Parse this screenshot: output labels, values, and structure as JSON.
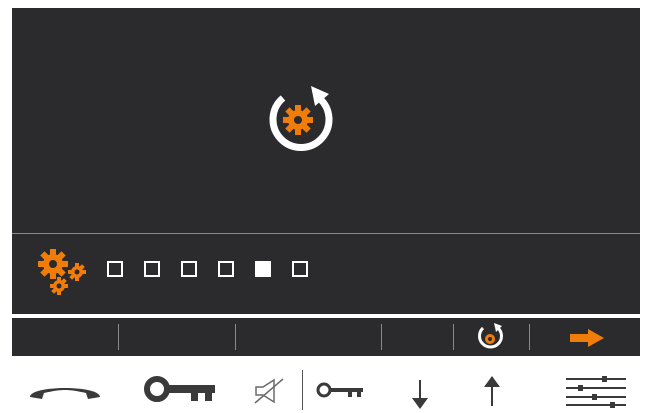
{
  "screen": {
    "center_icon": "settings-refresh-icon",
    "progress": {
      "total_steps": 6,
      "current_step": 5,
      "icon": "gears-icon"
    }
  },
  "softkeys": [
    {
      "name": "softkey-1",
      "icon": ""
    },
    {
      "name": "softkey-2",
      "icon": ""
    },
    {
      "name": "softkey-3",
      "icon": ""
    },
    {
      "name": "softkey-4",
      "icon": ""
    },
    {
      "name": "softkey-5",
      "icon": "settings-refresh-icon"
    },
    {
      "name": "softkey-6",
      "icon": "arrow-right-icon"
    }
  ],
  "hardware_buttons": [
    {
      "name": "handset-button",
      "icon": "handset-icon"
    },
    {
      "name": "door-key-button",
      "icon": "key-icon"
    },
    {
      "name": "mute-button",
      "icon": "speaker-mute-icon"
    },
    {
      "name": "key-small-button",
      "icon": "key-small-icon"
    },
    {
      "name": "arrow-down-button",
      "icon": "arrow-down-icon"
    },
    {
      "name": "arrow-up-button",
      "icon": "arrow-up-icon"
    },
    {
      "name": "settings-menu-button",
      "icon": "sliders-icon"
    }
  ],
  "colors": {
    "accent": "#f07d0a",
    "screen_bg": "#2b2b2d",
    "foreground": "#ffffff"
  }
}
